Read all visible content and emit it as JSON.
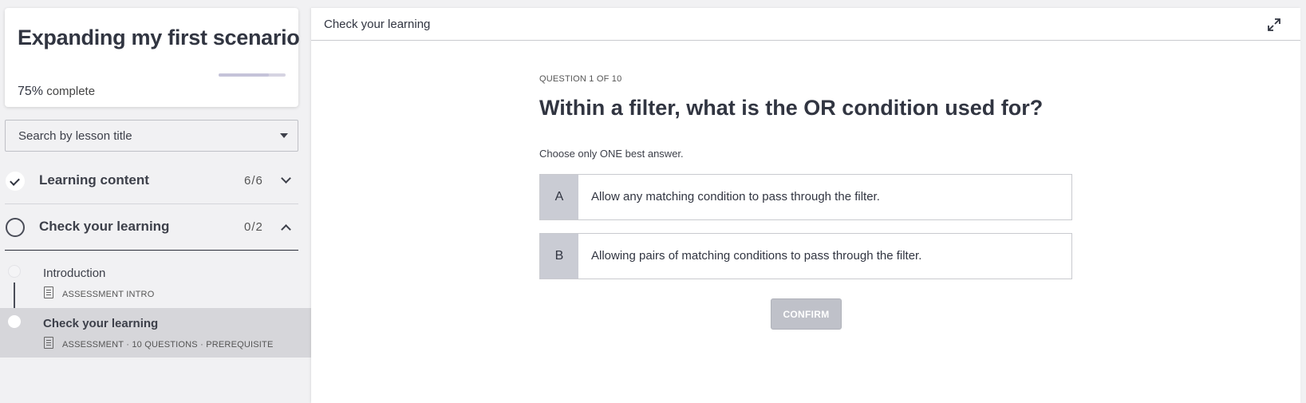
{
  "course": {
    "title": "Expanding my first scenario",
    "progress_percent": "75%",
    "progress_suffix": "complete",
    "progress_value": 0.75
  },
  "search": {
    "label": "Search by lesson title"
  },
  "sections": [
    {
      "title": "Learning content",
      "count": "6/6",
      "status": "complete",
      "expanded": false
    },
    {
      "title": "Check your learning",
      "count": "0/2",
      "status": "not-started",
      "expanded": true
    }
  ],
  "lessons": [
    {
      "name": "Introduction",
      "meta": "ASSESSMENT INTRO",
      "active": false
    },
    {
      "name": "Check your learning",
      "meta": "ASSESSMENT · 10 QUESTIONS · PREREQUISITE",
      "active": true
    }
  ],
  "main": {
    "header_title": "Check your learning",
    "question_label": "QUESTION 1 OF 10",
    "question_before": "Within a filter, what is the ",
    "question_bold": "OR",
    "question_after": " condition used for?",
    "instruction": "Choose only ONE best answer.",
    "options": [
      {
        "letter": "A",
        "text": "Allow any matching condition to pass through the filter."
      },
      {
        "letter": "B",
        "text": "Allowing pairs of matching conditions to pass through the filter."
      }
    ],
    "confirm_label": "CONFIRM"
  },
  "icons": {
    "check": "checkmark-icon",
    "chevron_down": "chevron-down-icon",
    "chevron_up": "chevron-up-icon",
    "expand": "expand-icon",
    "document": "document-icon"
  }
}
